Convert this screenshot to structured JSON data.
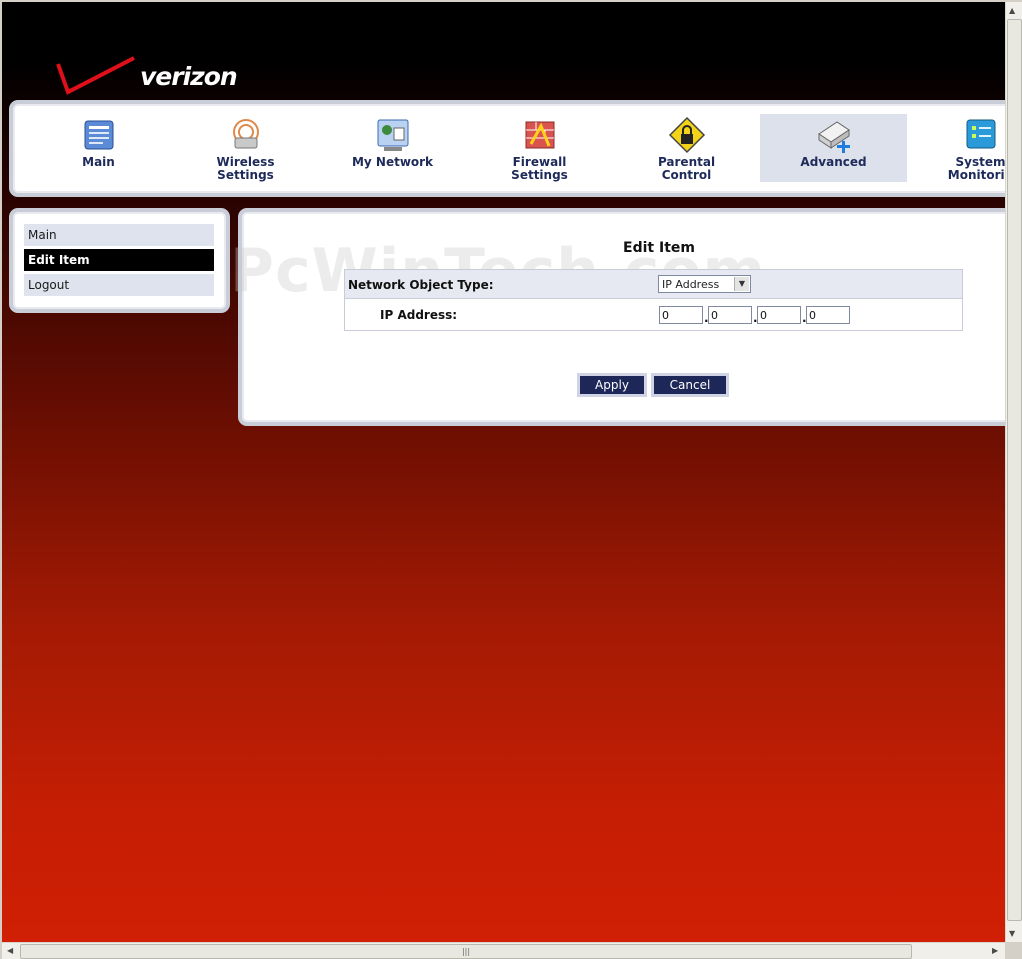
{
  "logo": {
    "text": "verizon"
  },
  "nav": {
    "items": [
      {
        "label": "Main",
        "icon": "main-icon"
      },
      {
        "label": "Wireless\nSettings",
        "icon": "wireless-icon"
      },
      {
        "label": "My Network",
        "icon": "network-icon"
      },
      {
        "label": "Firewall\nSettings",
        "icon": "firewall-icon"
      },
      {
        "label": "Parental\nControl",
        "icon": "lock-icon"
      },
      {
        "label": "Advanced",
        "icon": "advanced-icon",
        "active": true
      },
      {
        "label": "System\nMonitorin",
        "icon": "monitor-icon"
      }
    ]
  },
  "sidebar": {
    "items": [
      {
        "label": "Main"
      },
      {
        "label": "Edit Item",
        "active": true
      },
      {
        "label": "Logout"
      }
    ]
  },
  "panel": {
    "title": "Edit Item",
    "type_label": "Network Object Type:",
    "type_value": "IP Address",
    "ip_label": "IP Address:",
    "ip": [
      "0",
      "0",
      "0",
      "0"
    ],
    "apply_label": "Apply",
    "cancel_label": "Cancel"
  },
  "watermark": "PcWinTech.com",
  "colors": {
    "nav_text": "#1e2a5a",
    "button_bg": "#1d2758",
    "active_side": "#000000",
    "bg_bottom": "#d01f04"
  }
}
